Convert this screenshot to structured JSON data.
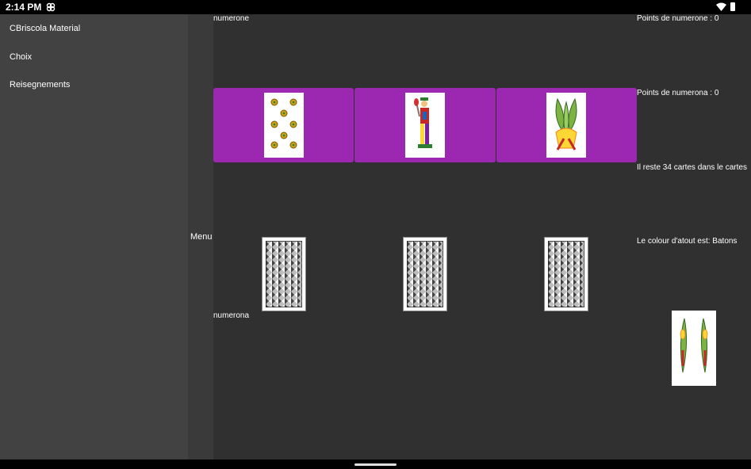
{
  "status": {
    "time": "2:14 PM"
  },
  "drawer": {
    "items": [
      {
        "label": "CBriscola Material"
      },
      {
        "label": "Choix"
      },
      {
        "label": "Reisegnements"
      }
    ]
  },
  "rail": {
    "menu_label": "Menu"
  },
  "game": {
    "top_player": "numerone",
    "bottom_player": "numerona",
    "hand_cards": [
      {
        "card": "8-of-coins-card",
        "suit": "coins"
      },
      {
        "card": "jack-of-cups-card",
        "suit": "cups"
      },
      {
        "card": "3-of-batons-card",
        "suit": "batons"
      }
    ],
    "opponent_card_count": 3,
    "trump_card": "2-of-batons-card"
  },
  "info": {
    "points_top": "Points de numerone  : 0",
    "points_bottom": "Points de numerona  : 0",
    "remaining": "Il reste 34 cartes dans le cartes",
    "trump": "Le colour d'atout est: Batons"
  },
  "colors": {
    "hand_background": "#9c27b0",
    "table_background": "#303030",
    "drawer_background": "#424242"
  }
}
